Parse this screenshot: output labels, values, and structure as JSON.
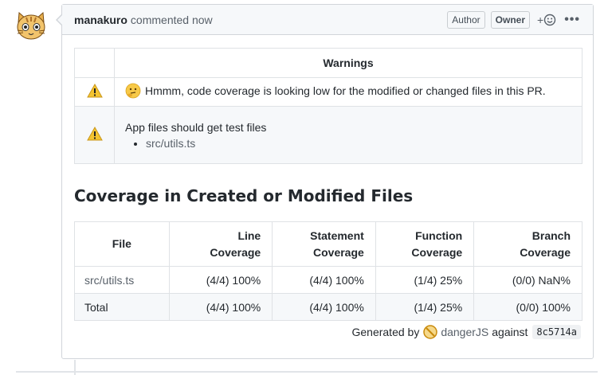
{
  "comment": {
    "author": "manakuro",
    "action": "commented now",
    "badges": [
      "Author",
      "Owner"
    ],
    "reaction_label": "+",
    "more_label": "•••"
  },
  "warnings": {
    "header": "Warnings",
    "items": [
      {
        "icon": "warning-icon",
        "emoji": "thinking-face-icon",
        "text": "Hmmm, code coverage is looking low for the modified or changed files in this PR."
      },
      {
        "icon": "warning-icon",
        "text": "App files should get test files",
        "files": [
          "src/utils.ts"
        ]
      }
    ]
  },
  "coverage": {
    "title": "Coverage in Created or Modified Files",
    "headers": {
      "file": "File",
      "line": [
        "Line",
        "Coverage"
      ],
      "statement": [
        "Statement",
        "Coverage"
      ],
      "function": [
        "Function",
        "Coverage"
      ],
      "branch": [
        "Branch",
        "Coverage"
      ]
    },
    "rows": [
      {
        "file": "src/utils.ts",
        "line": "(4/4) 100%",
        "statement": "(4/4) 100%",
        "function": "(1/4) 25%",
        "branch": "(0/0) NaN%"
      },
      {
        "file": "Total",
        "line": "(4/4) 100%",
        "statement": "(4/4) 100%",
        "function": "(1/4) 25%",
        "branch": "(0/0) 100%"
      }
    ]
  },
  "footer": {
    "generated_by": "Generated by",
    "tool": "dangerJS",
    "against": "against",
    "sha": "8c5714a"
  },
  "colors": {
    "warning": "#f4c430",
    "link": "#586069",
    "border": "#d1d5da"
  }
}
